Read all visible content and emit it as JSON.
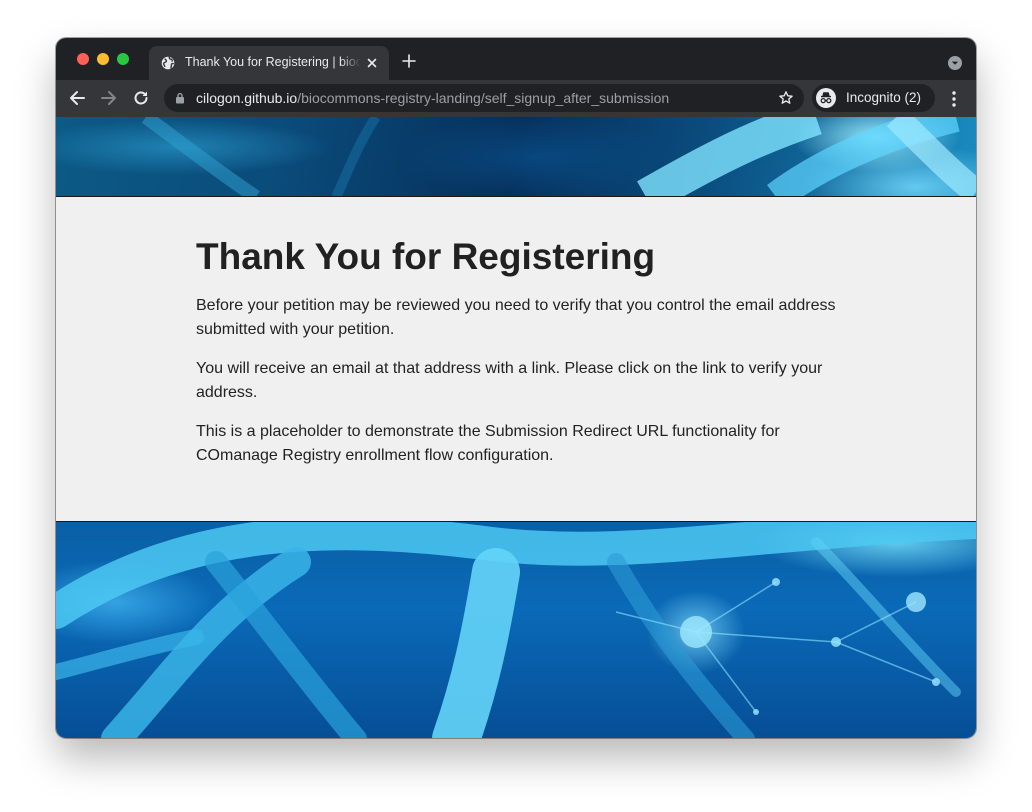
{
  "browser": {
    "tab_title": "Thank You for Registering | biocommons",
    "url_host": "cilogon.github.io",
    "url_path": "/biocommons-registry-landing/self_signup_after_submission",
    "incognito_label": "Incognito (2)",
    "icons": [
      "globe-icon",
      "close-icon",
      "plus-icon",
      "chevron-down-icon",
      "back-arrow-icon",
      "forward-arrow-icon",
      "reload-icon",
      "lock-icon",
      "star-icon",
      "incognito-icon",
      "kebab-menu-icon"
    ]
  },
  "page": {
    "heading": "Thank You for Registering",
    "paragraphs": [
      "Before your petition may be reviewed you need to verify that you control the email address submitted with your petition.",
      "You will receive an email at that address with a link. Please click on the link to verify your address.",
      "This is a placeholder to demonstrate the Submission Redirect URL functionality for COmanage Registry enrollment flow configuration."
    ]
  },
  "colors": {
    "tab_bar_bg": "#202124",
    "toolbar_bg": "#35363a",
    "page_bg": "#f0f0f0",
    "banner_blue": "#0a5fa4"
  }
}
